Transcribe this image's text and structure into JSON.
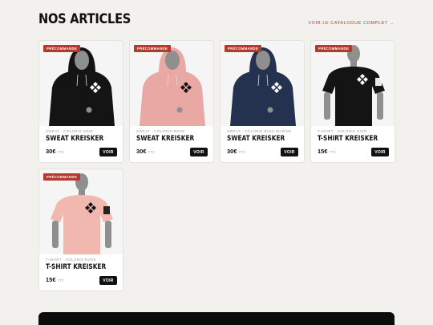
{
  "section": {
    "title": "NOS ARTICLES",
    "catalog_link": "VOIR LE CATALOGUE COMPLET →"
  },
  "products": [
    {
      "badge": "PRÉCOMMANDE",
      "category": "SWEAT · COLORIS NOIR",
      "name": "SWEAT KREISKER",
      "price": "30€",
      "tax": "TTC",
      "cta": "VOIR",
      "image": "hoodie",
      "color": "#141414"
    },
    {
      "badge": "PRÉCOMMANDE",
      "category": "SWEAT · COLORIS ROSE",
      "name": "SWEAT KREISKER",
      "price": "30€",
      "tax": "TTC",
      "cta": "VOIR",
      "image": "hoodie",
      "color": "#e9a8a3"
    },
    {
      "badge": "PRÉCOMMANDE",
      "category": "SWEAT · COLORIS BLEU MARINE",
      "name": "SWEAT KREISKER",
      "price": "30€",
      "tax": "TTC",
      "cta": "VOIR",
      "image": "hoodie",
      "color": "#24324f"
    },
    {
      "badge": "PRÉCOMMANDE",
      "category": "T-SHIRT · COLORIS NOIR",
      "name": "T-SHIRT KREISKER",
      "price": "15€",
      "tax": "TTC",
      "cta": "VOIR",
      "image": "tshirt",
      "color": "#141414"
    },
    {
      "badge": "PRÉCOMMANDE",
      "category": "T-SHIRT · COLORIS ROSE",
      "name": "T-SHIRT KREISKER",
      "price": "15€",
      "tax": "TTC",
      "cta": "VOIR",
      "image": "tshirt",
      "color": "#f1b8b0"
    }
  ],
  "colors": {
    "accent": "#b6392e",
    "background": "#f3f1ee",
    "mannequin": "#8f8f8f"
  }
}
